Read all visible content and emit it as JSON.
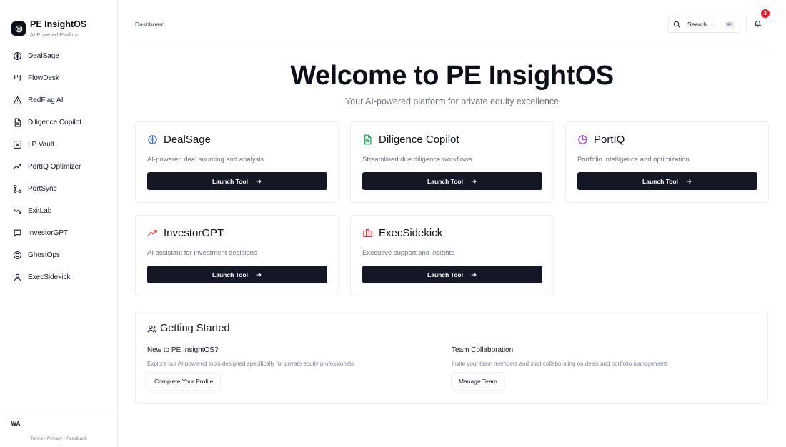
{
  "brand": {
    "title": "PE InsightOS",
    "subtitle": "AI-Powered Platform"
  },
  "sidebar": {
    "items": [
      {
        "label": "DealSage",
        "icon": "brain-icon"
      },
      {
        "label": "FlowDesk",
        "icon": "bars-icon"
      },
      {
        "label": "RedFlag AI",
        "icon": "alert-triangle-icon"
      },
      {
        "label": "Diligence Copilot",
        "icon": "document-icon"
      },
      {
        "label": "LP Vault",
        "icon": "vault-icon"
      },
      {
        "label": "PortIQ Optimizer",
        "icon": "trending-up-icon"
      },
      {
        "label": "PortSync",
        "icon": "network-icon"
      },
      {
        "label": "ExitLab",
        "icon": "trending-down-icon"
      },
      {
        "label": "InvestorGPT",
        "icon": "chat-icon"
      },
      {
        "label": "GhostOps",
        "icon": "globe-icon"
      },
      {
        "label": "ExecSidekick",
        "icon": "user-icon"
      }
    ],
    "avatar": "WA",
    "footer": {
      "terms": "Terms",
      "privacy": "Privacy",
      "feedback": "Feedback",
      "sep": " • "
    }
  },
  "header": {
    "breadcrumb": "Dashboard",
    "search_placeholder": "Search...",
    "search_shortcut": "⌘K",
    "notification_count": "3"
  },
  "hero": {
    "title": "Welcome to PE InsightOS",
    "subtitle": "Your AI-powered platform for private equity excellence"
  },
  "tools": [
    {
      "name": "DealSage",
      "desc": "AI-powered deal sourcing and analysis",
      "button": "Launch Tool",
      "icon": "brain-icon",
      "color": "#3b6fe0"
    },
    {
      "name": "Diligence Copilot",
      "desc": "Streamlined due diligence workflows",
      "button": "Launch Tool",
      "icon": "file-search-icon",
      "color": "#22a355"
    },
    {
      "name": "PortIQ",
      "desc": "Portfolio intelligence and optimization",
      "button": "Launch Tool",
      "icon": "pie-chart-icon",
      "color": "#a23fe0"
    },
    {
      "name": "InvestorGPT",
      "desc": "AI assistant for investment decisions",
      "button": "Launch Tool",
      "icon": "trending-up-icon",
      "color": "#e04a3b"
    },
    {
      "name": "ExecSidekick",
      "desc": "Executive support and insights",
      "button": "Launch Tool",
      "icon": "briefcase-icon",
      "color": "#e0343b"
    }
  ],
  "getting_started": {
    "title": "Getting Started",
    "left": {
      "title": "New to PE InsightOS?",
      "text": "Explore our AI-powered tools designed specifically for private equity professionals.",
      "button": "Complete Your Profile"
    },
    "right": {
      "title": "Team Collaboration",
      "text": "Invite your team members and start collaborating on deals and portfolio management.",
      "button": "Manage Team"
    }
  }
}
